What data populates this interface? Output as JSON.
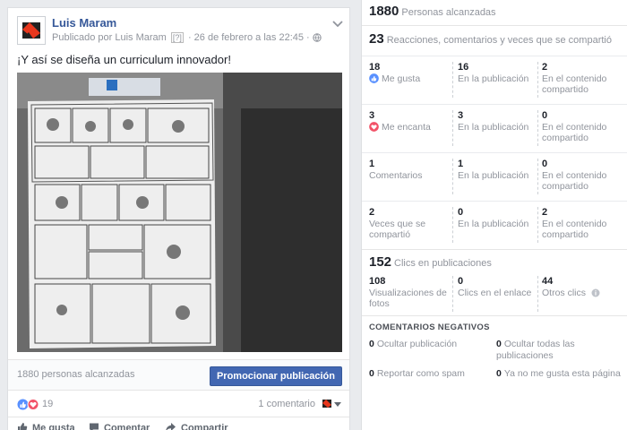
{
  "post": {
    "author": "Luis Maram",
    "meta_prefix": "Publicado por",
    "meta_author": "Luis Maram",
    "meta_q": "[?]",
    "meta_date": "· 26 de febrero a las 22:45 ·",
    "text": "¡Y así se diseña un curriculum innovador!",
    "reach": "1880 personas alcanzadas",
    "promote": "Promocionar publicación",
    "reaction_count": "19",
    "comments": "1 comentario",
    "actions": {
      "like": "Me gusta",
      "comment": "Comentar",
      "share": "Compartir"
    }
  },
  "stats": {
    "reach_num": "1880",
    "reach_label": "Personas alcanzadas",
    "engage_num": "23",
    "engage_label": "Reacciones, comentarios y veces que se compartió",
    "rows": [
      {
        "n1": "18",
        "l1": "Me gusta",
        "n2": "16",
        "l2": "En la publicación",
        "n3": "2",
        "l3": "En el contenido compartido"
      },
      {
        "n1": "3",
        "l1": "Me encanta",
        "n2": "3",
        "l2": "En la publicación",
        "n3": "0",
        "l3": "En el contenido compartido"
      },
      {
        "n1": "1",
        "l1": "Comentarios",
        "n2": "1",
        "l2": "En la publicación",
        "n3": "0",
        "l3": "En el contenido compartido"
      },
      {
        "n1": "2",
        "l1": "Veces que se compartió",
        "n2": "0",
        "l2": "En la publicación",
        "n3": "2",
        "l3": "En el contenido compartido"
      }
    ],
    "clicks_num": "152",
    "clicks_label": "Clics en publicaciones",
    "clicks": {
      "n1": "108",
      "l1": "Visualizaciones de fotos",
      "n2": "0",
      "l2": "Clics en el enlace",
      "n3": "44",
      "l3": "Otros clics"
    },
    "negative_title": "COMENTARIOS NEGATIVOS",
    "negative": [
      {
        "n": "0",
        "l": "Ocultar publicación"
      },
      {
        "n": "0",
        "l": "Ocultar todas las publicaciones"
      },
      {
        "n": "0",
        "l": "Reportar como spam"
      },
      {
        "n": "0",
        "l": "Ya no me gusta esta página"
      }
    ]
  },
  "colors": {
    "link": "#365899",
    "button": "#4267b2",
    "like": "#5890ff",
    "love": "#f25268"
  }
}
